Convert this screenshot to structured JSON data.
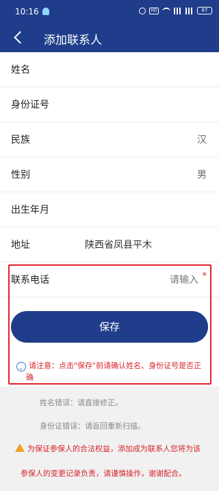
{
  "status_bar": {
    "time": "10:16",
    "battery": "87"
  },
  "header": {
    "title": "添加联系人"
  },
  "form": {
    "name_label": "姓名",
    "id_label": "身份证号",
    "ethnicity_label": "民族",
    "ethnicity_value": "汉",
    "gender_label": "性别",
    "gender_value": "男",
    "birth_label": "出生年月",
    "address_label": "地址",
    "address_value": "陕西省凤县平木",
    "phone_label": "联系电话",
    "phone_placeholder": "请输入",
    "required_mark": "*"
  },
  "actions": {
    "save_label": "保存"
  },
  "notice": {
    "line1": "请注意：点击\"保存\"前请确认姓名、身份证号是否正",
    "line2": "确"
  },
  "hints": {
    "name_error": "姓名错误：请直接修正。",
    "id_error": "身份证错误：请返回重新扫描。"
  },
  "warning": {
    "line1": "为保证参保人的合法权益，添加成为联系人您将为该",
    "line2": "参保人的变更记录负责，请谨慎操作，谢谢配合。"
  },
  "colors": {
    "primary": "#1f3d8a",
    "alert": "#d8252c",
    "highlight_box": "#e2202a"
  }
}
